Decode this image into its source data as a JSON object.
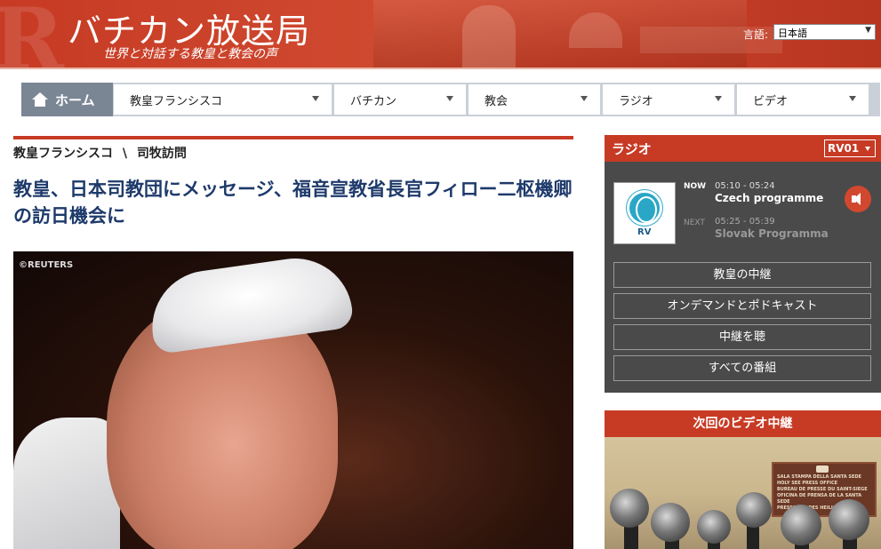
{
  "header": {
    "title": "バチカン放送局",
    "subtitle": "世界と対話する教皇と教会の声",
    "language_label": "言語:",
    "language_selected": "日本語"
  },
  "nav": {
    "home": "ホーム",
    "items": [
      "教皇フランシスコ",
      "バチカン",
      "教会",
      "ラジオ",
      "ビデオ"
    ]
  },
  "article": {
    "breadcrumb": [
      "教皇フランシスコ",
      "\\",
      "司牧訪問"
    ],
    "headline": "教皇、日本司教団にメッセージ、福音宣教省長官フィロー二枢機卿の訪日機会に",
    "photo_credit": "©REUTERS"
  },
  "radio": {
    "title": "ラジオ",
    "channel": "RV01",
    "logo_text": "RV",
    "now_label": "NOW",
    "now_time": "05:10 - 05:24",
    "now_programme": "Czech programme",
    "next_label": "NEXT",
    "next_time": "05:25 - 05:39",
    "next_programme": "Slovak Programma",
    "buttons": [
      "教皇の中継",
      "オンデマンドとポドキャスト",
      "中継を聴",
      "すべての番組"
    ]
  },
  "video": {
    "title": "次回のビデオ中継",
    "plaque_lines": [
      "SALA STAMPA DELLA SANTA SEDE",
      "HOLY SEE PRESS OFFICE",
      "BUREAU DE PRESSE DU SAINT-SIEGE",
      "OFICINA DE PRENSA DE LA SANTA SEDE",
      "PRESSEAMT DES HEILIGEN STUHLS"
    ]
  },
  "colors": {
    "brand_red": "#c73a24",
    "headline_blue": "#1e3a6b",
    "sidebar_gray": "#4a4a4a"
  }
}
